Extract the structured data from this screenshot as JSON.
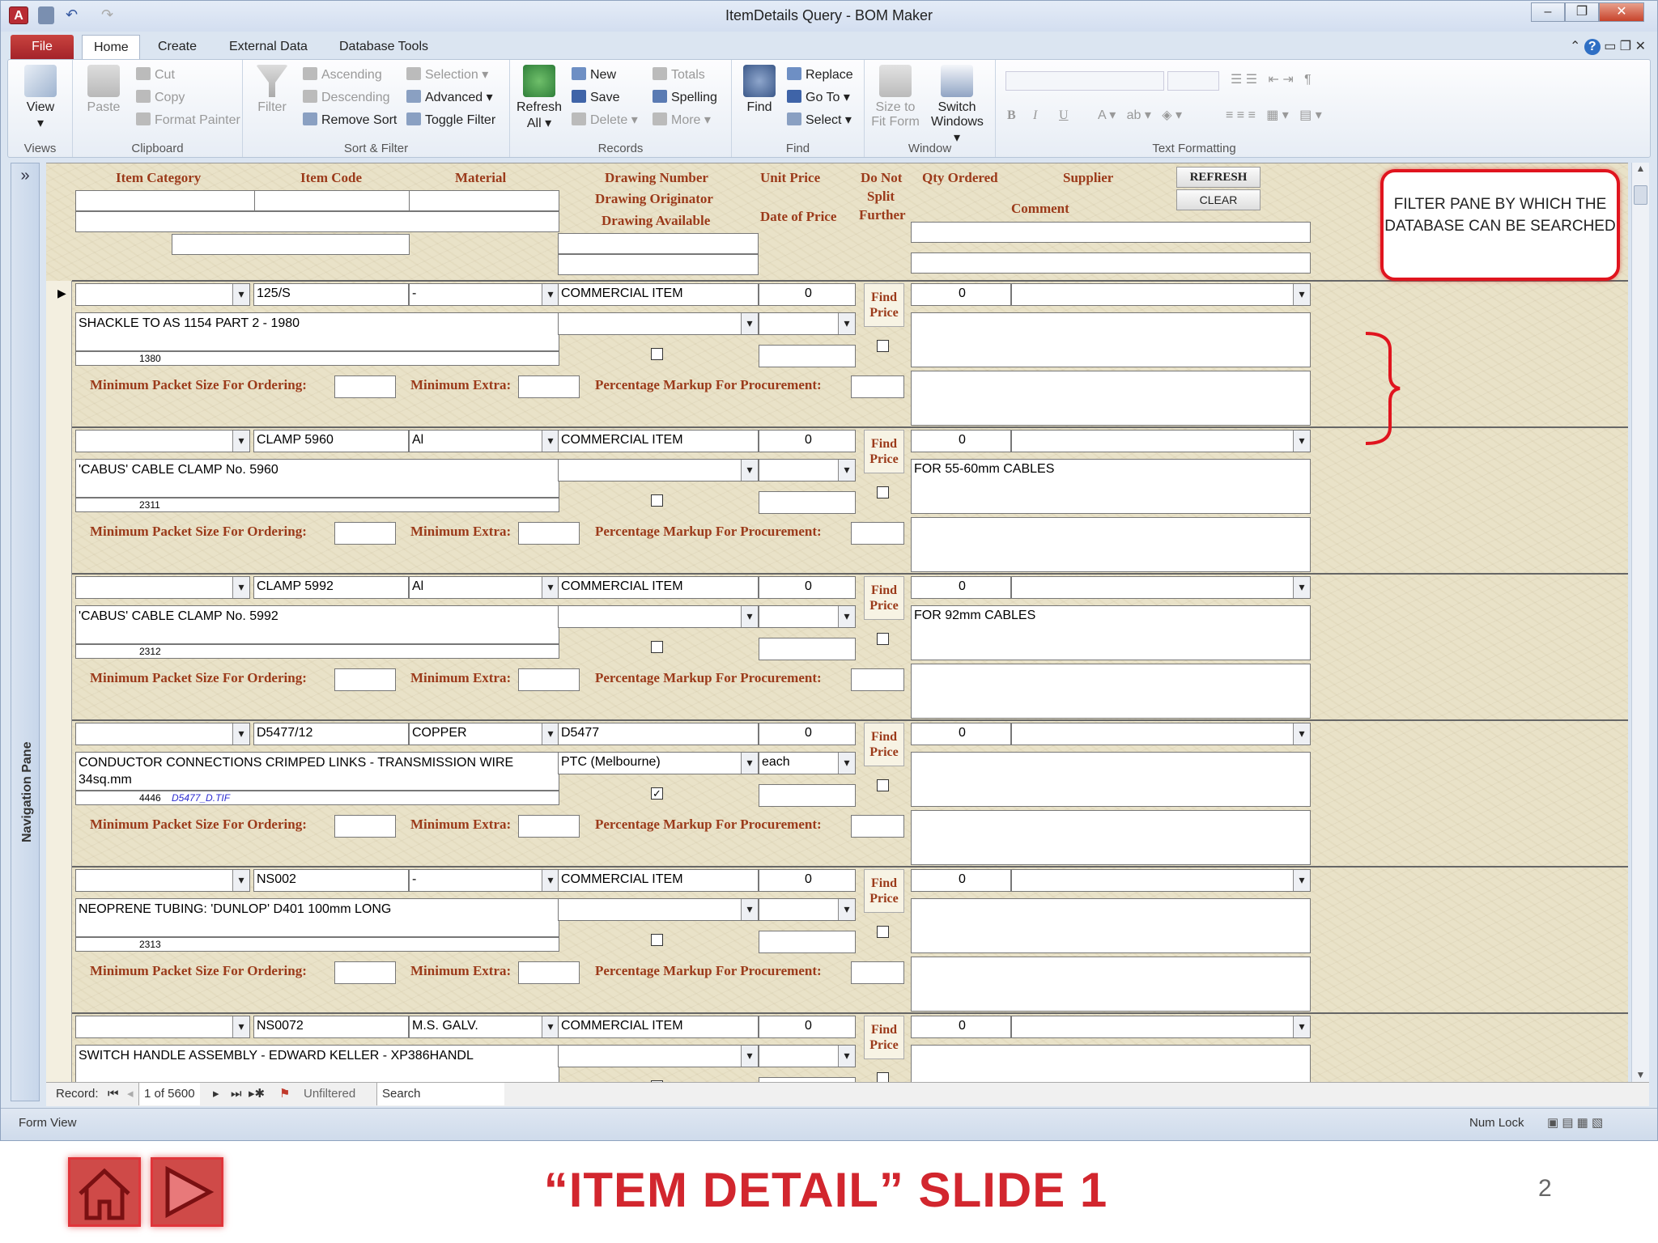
{
  "window": {
    "title": "ItemDetails Query - BOM Maker"
  },
  "ribbon_tabs": [
    "File",
    "Home",
    "Create",
    "External Data",
    "Database Tools"
  ],
  "ribbon": {
    "views": {
      "label": "Views",
      "view": "View"
    },
    "clipboard": {
      "label": "Clipboard",
      "paste": "Paste",
      "cut": "Cut",
      "copy": "Copy",
      "format_painter": "Format Painter"
    },
    "sort_filter": {
      "label": "Sort & Filter",
      "filter": "Filter",
      "ascending": "Ascending",
      "descending": "Descending",
      "remove_sort": "Remove Sort",
      "selection": "Selection",
      "advanced": "Advanced",
      "toggle_filter": "Toggle Filter"
    },
    "records": {
      "label": "Records",
      "refresh": "Refresh",
      "refresh_all": "All",
      "new": "New",
      "save": "Save",
      "delete": "Delete",
      "totals": "Totals",
      "spelling": "Spelling",
      "more": "More"
    },
    "find": {
      "label": "Find",
      "find": "Find",
      "replace": "Replace",
      "goto": "Go To",
      "select": "Select"
    },
    "window": {
      "label": "Window",
      "size_to": "Size to",
      "fit_form": "Fit Form",
      "switch": "Switch",
      "windows": "Windows"
    },
    "text_formatting": {
      "label": "Text Formatting",
      "bold": "B",
      "italic": "I",
      "underline": "U"
    }
  },
  "nav_pane": {
    "label": "Navigation Pane",
    "toggle": "»"
  },
  "filter_pane": {
    "labels": {
      "item_category": "Item Category",
      "item_code": "Item Code",
      "material": "Material",
      "drawing_number": "Drawing Number",
      "drawing_originator": "Drawing Originator",
      "drawing_available": "Drawing Available",
      "unit_price": "Unit Price",
      "date_of_price": "Date of Price",
      "do_not_split": "Do Not",
      "split": "Split",
      "further": "Further",
      "qty_ordered": "Qty Ordered",
      "supplier": "Supplier",
      "comment": "Comment"
    },
    "refresh_button": "REFRESH",
    "clear_button": "CLEAR"
  },
  "row_labels": {
    "min_packet": "Minimum Packet Size For Ordering:",
    "min_extra": "Minimum Extra:",
    "pct_markup": "Percentage Markup For Procurement:",
    "find_price": "Find Price"
  },
  "records": [
    {
      "code": "125/S",
      "material": "-",
      "drawing": "COMMERCIAL ITEM",
      "price": "0",
      "qty": "0",
      "description": "SHACKLE TO AS 1154 PART 2 - 1980",
      "id": "1380",
      "originator": "",
      "unit": "",
      "file": "",
      "available": false,
      "comment": ""
    },
    {
      "code": "CLAMP 5960",
      "material": "Al",
      "drawing": "COMMERCIAL ITEM",
      "price": "0",
      "qty": "0",
      "description": "'CABUS' CABLE CLAMP No. 5960",
      "id": "2311",
      "originator": "",
      "unit": "",
      "file": "",
      "available": false,
      "comment": "FOR 55-60mm CABLES"
    },
    {
      "code": "CLAMP 5992",
      "material": "Al",
      "drawing": "COMMERCIAL ITEM",
      "price": "0",
      "qty": "0",
      "description": "'CABUS' CABLE CLAMP No. 5992",
      "id": "2312",
      "originator": "",
      "unit": "",
      "file": "",
      "available": false,
      "comment": "FOR 92mm CABLES"
    },
    {
      "code": "D5477/12",
      "material": "COPPER",
      "drawing": "D5477",
      "price": "0",
      "qty": "0",
      "description": "CONDUCTOR CONNECTIONS CRIMPED LINKS - TRANSMISSION WIRE 34sq.mm",
      "id": "4446",
      "originator": "PTC (Melbourne)",
      "unit": "each",
      "file": "D5477_D.TIF",
      "available": true,
      "comment": ""
    },
    {
      "code": "NS002",
      "material": "-",
      "drawing": "COMMERCIAL ITEM",
      "price": "0",
      "qty": "0",
      "description": "NEOPRENE TUBING: 'DUNLOP' D401 100mm LONG",
      "id": "2313",
      "originator": "",
      "unit": "",
      "file": "",
      "available": false,
      "comment": ""
    },
    {
      "code": "NS0072",
      "material": "M.S. GALV.",
      "drawing": "COMMERCIAL ITEM",
      "price": "0",
      "qty": "0",
      "description": "SWITCH HANDLE ASSEMBLY - EDWARD KELLER - XP386HANDL",
      "id": "",
      "originator": "",
      "unit": "",
      "file": "",
      "available": false,
      "comment": ""
    }
  ],
  "callout": {
    "text": "FILTER PANE BY WHICH THE DATABASE CAN BE SEARCHED"
  },
  "record_nav": {
    "label": "Record:",
    "position": "1 of 5600",
    "filter_state": "Unfiltered",
    "search": "Search"
  },
  "status": {
    "left": "Form View",
    "numlock": "Num Lock"
  },
  "slide": {
    "title": "“ITEM DETAIL” SLIDE 1",
    "page": "2"
  },
  "colors": {
    "label_brown": "#9b3a1a",
    "callout_red": "#e0141e",
    "file_tab": "#b52b31",
    "form_bg": "#e9e2c8"
  }
}
